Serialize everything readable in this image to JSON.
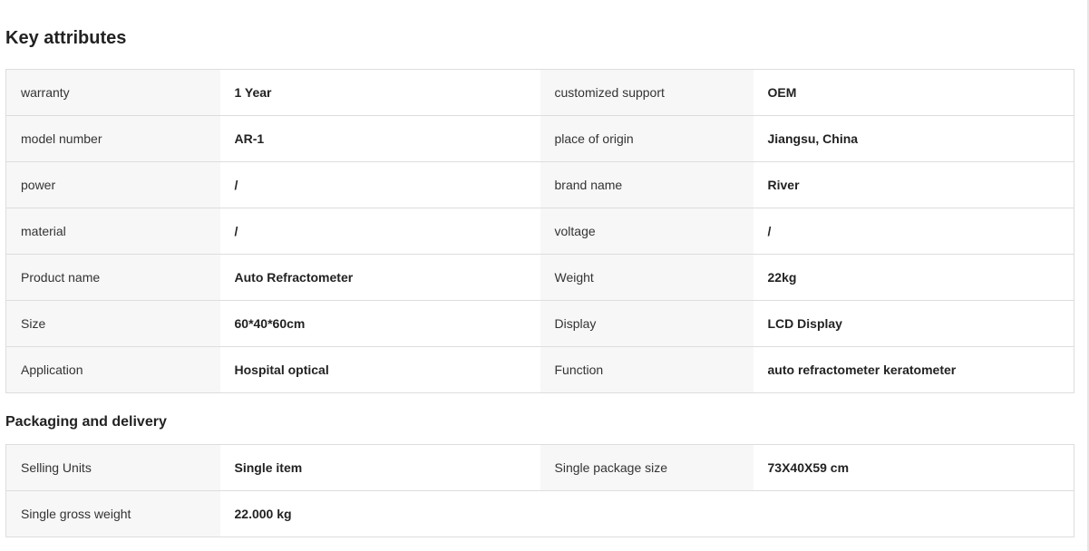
{
  "key_attributes": {
    "title": "Key attributes",
    "rows": [
      {
        "l1": "warranty",
        "v1": "1 Year",
        "l2": "customized support",
        "v2": "OEM"
      },
      {
        "l1": "model number",
        "v1": "AR-1",
        "l2": "place of origin",
        "v2": "Jiangsu, China"
      },
      {
        "l1": "power",
        "v1": "/",
        "l2": "brand name",
        "v2": "River"
      },
      {
        "l1": "material",
        "v1": "/",
        "l2": "voltage",
        "v2": "/"
      },
      {
        "l1": "Product name",
        "v1": "Auto Refractometer",
        "l2": "Weight",
        "v2": "22kg"
      },
      {
        "l1": "Size",
        "v1": "60*40*60cm",
        "l2": "Display",
        "v2": "LCD Display"
      },
      {
        "l1": "Application",
        "v1": "Hospital optical",
        "l2": "Function",
        "v2": "auto refractometer keratometer"
      }
    ]
  },
  "packaging": {
    "title": "Packaging and delivery",
    "rows": [
      {
        "l1": "Selling Units",
        "v1": "Single item",
        "l2": "Single package size",
        "v2": "73X40X59 cm"
      },
      {
        "l1": "Single gross weight",
        "v1": "22.000 kg",
        "l2": "",
        "v2": ""
      }
    ]
  }
}
